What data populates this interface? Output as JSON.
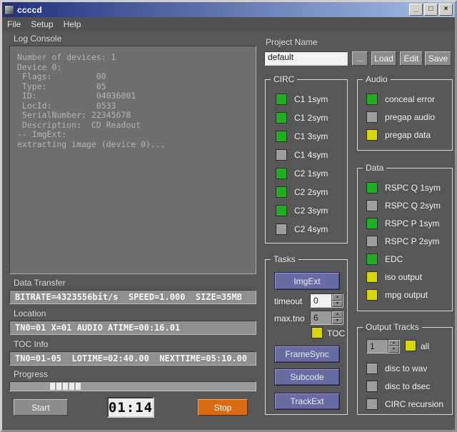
{
  "window": {
    "title": "ccccd",
    "minimize": "_",
    "maximize": "□",
    "close": "×"
  },
  "menu": {
    "items": [
      "File",
      "Setup",
      "Help"
    ]
  },
  "log_console": {
    "label": "Log Console",
    "text": "Number of devices: 1\nDevice 0:\n Flags:         00\n Type:          05\n ID:            04036001\n LocId:         0533\n SerialNumber: 22345678\n Description:  CD Readout\n-- ImgExt:\nextracting image (device 0)..."
  },
  "project": {
    "label": "Project Name",
    "value": "default",
    "browse_label": "...",
    "load_label": "Load",
    "edit_label": "Edit",
    "save_label": "Save"
  },
  "circ": {
    "title": "CIRC",
    "items": [
      {
        "label": "C1 1sym",
        "state": "green"
      },
      {
        "label": "C1 2sym",
        "state": "green"
      },
      {
        "label": "C1 3sym",
        "state": "green"
      },
      {
        "label": "C1 4sym",
        "state": "gray"
      },
      {
        "label": "C2 1sym",
        "state": "green"
      },
      {
        "label": "C2 2sym",
        "state": "green"
      },
      {
        "label": "C2 3sym",
        "state": "green"
      },
      {
        "label": "C2 4sym",
        "state": "gray"
      }
    ]
  },
  "audio": {
    "title": "Audio",
    "items": [
      {
        "label": "conceal error",
        "state": "green"
      },
      {
        "label": "pregap audio",
        "state": "gray"
      },
      {
        "label": "pregap data",
        "state": "yellow"
      }
    ]
  },
  "data_group": {
    "title": "Data",
    "items": [
      {
        "label": "RSPC Q 1sym",
        "state": "green"
      },
      {
        "label": "RSPC Q 2sym",
        "state": "gray"
      },
      {
        "label": "RSPC P 1sym",
        "state": "green"
      },
      {
        "label": "RSPC P 2sym",
        "state": "gray"
      },
      {
        "label": "EDC",
        "state": "green"
      },
      {
        "label": "iso output",
        "state": "yellow"
      },
      {
        "label": "mpg output",
        "state": "yellow"
      }
    ]
  },
  "tasks": {
    "title": "Tasks",
    "imgext_label": "ImgExt",
    "timeout_label": "timeout",
    "timeout_value": "0",
    "max_tno_label": "max.tno",
    "max_tno_value": "6",
    "toc_label": "TOC",
    "framesync_label": "FrameSync",
    "subcode_label": "Subcode",
    "trackext_label": "TrackExt"
  },
  "output_tracks": {
    "title": "Output Tracks",
    "track_value": "1",
    "all_label": "all",
    "items": [
      {
        "label": "disc to wav",
        "state": "gray"
      },
      {
        "label": "disc to dsec",
        "state": "gray"
      },
      {
        "label": "CIRC recursion",
        "state": "gray"
      }
    ]
  },
  "status": {
    "data_transfer_label": "Data Transfer",
    "data_transfer_value": "BITRATE=4323556bit/s  SPEED=1.000  SIZE=35MB",
    "location_label": "Location",
    "location_value": "TN0=01 X=01 AUDIO ATIME=00:16.01",
    "toc_info_label": "TOC Info",
    "toc_info_value": "TN0=01-05  LOTIME=02:40.00  NEXTTIME=05:10.00",
    "progress_label": "Progress"
  },
  "progress_chunks": 5,
  "transport": {
    "start_label": "Start",
    "timer_value": "01:14",
    "stop_label": "Stop"
  },
  "colors": {
    "green": "#1fae1f",
    "yellow": "#d6d600",
    "gray_led": "#9e9e9e",
    "accent_button": "#6b6ba4",
    "stop": "#d96b12",
    "titlebar_start": "#22317c",
    "titlebar_end": "#a3bfe4"
  }
}
